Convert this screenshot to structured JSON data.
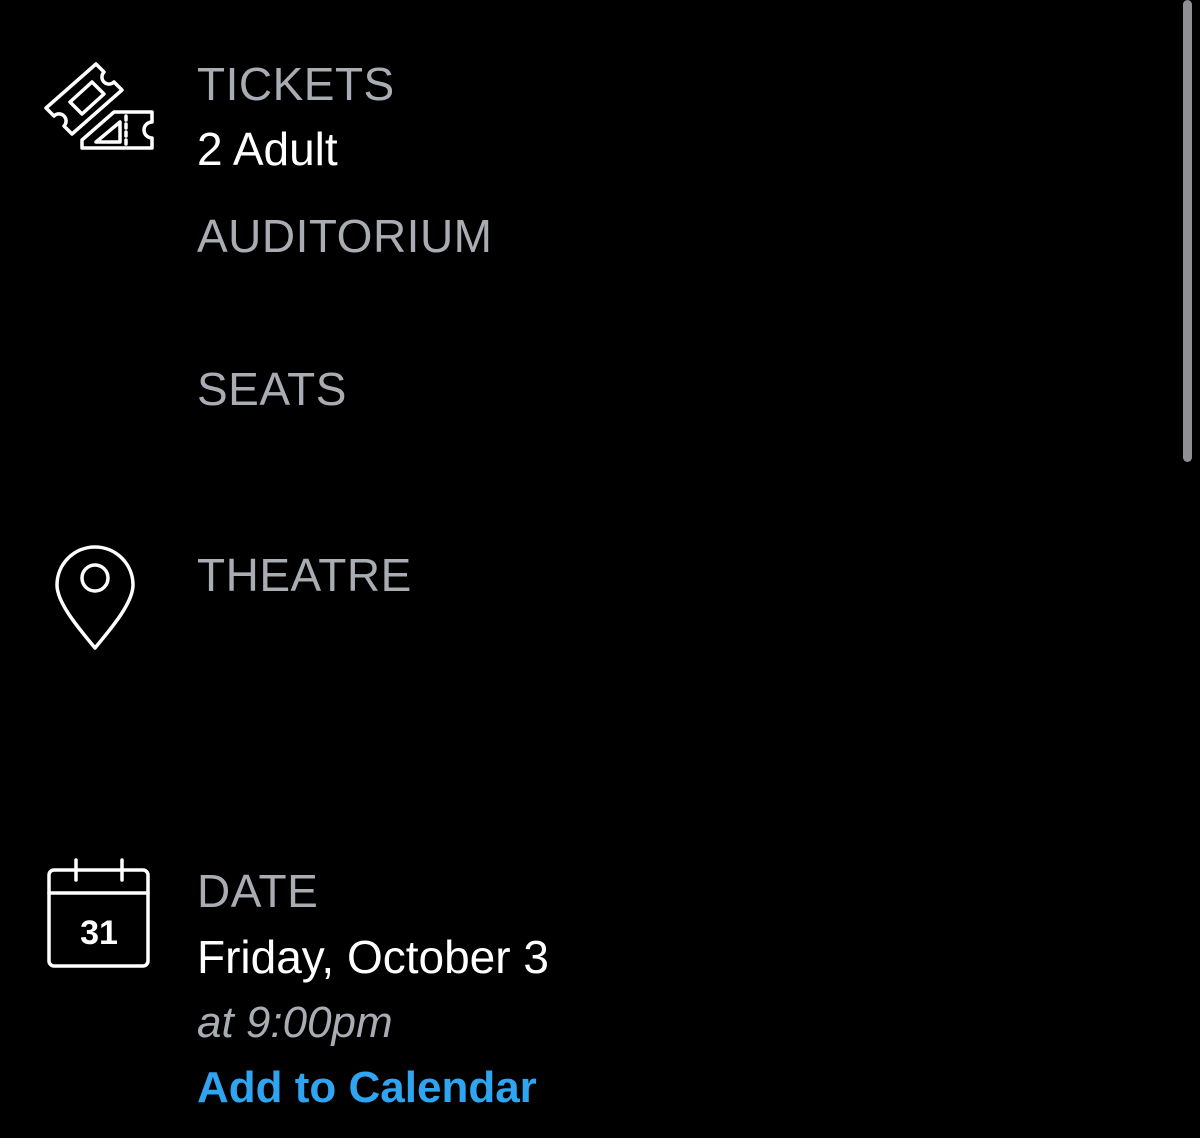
{
  "tickets": {
    "icon": "ticket-icon",
    "label": "TICKETS",
    "value": "2 Adult"
  },
  "auditorium": {
    "label": "AUDITORIUM"
  },
  "seats": {
    "label": "SEATS"
  },
  "theatre": {
    "icon": "map-pin-icon",
    "label": "THEATRE"
  },
  "date": {
    "icon": "calendar-icon",
    "calendar_day": "31",
    "label": "DATE",
    "value": "Friday, October 3",
    "time": "at 9:00pm",
    "add_to_calendar": "Add to Calendar"
  },
  "colors": {
    "background": "#000000",
    "label": "#a9adb3",
    "text": "#ffffff",
    "link": "#2fa4f0"
  }
}
